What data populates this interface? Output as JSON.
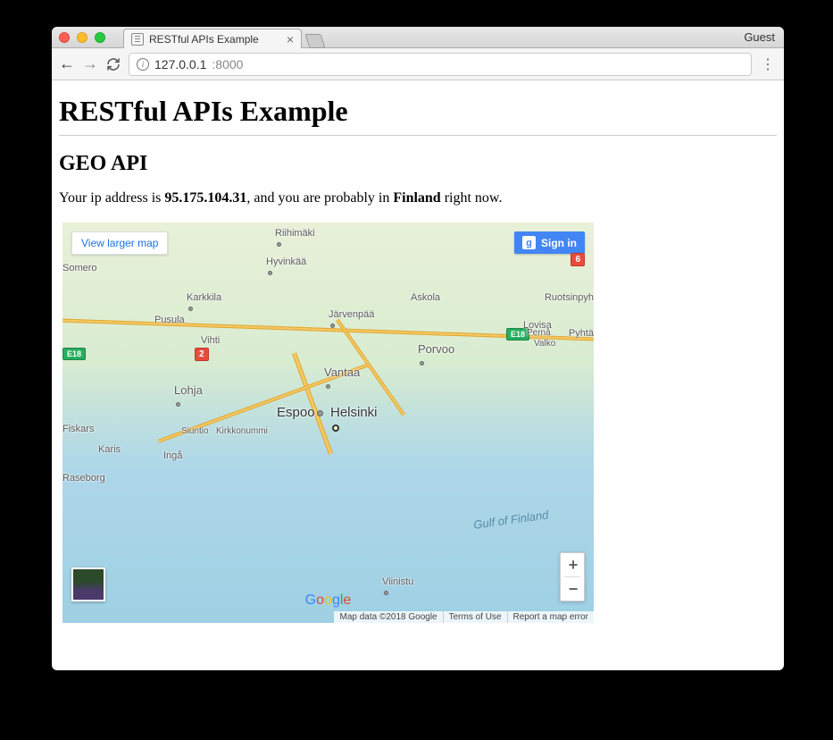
{
  "browser": {
    "guest_label": "Guest",
    "tab_title": "RESTful APIs Example",
    "url_host": "127.0.0.1",
    "url_port": ":8000"
  },
  "page": {
    "heading": "RESTful APIs Example",
    "subheading": "GEO API",
    "ip_prefix": "Your ip address is ",
    "ip_address": "95.175.104.31",
    "ip_mid": ", and you are probably in ",
    "country": "Finland",
    "ip_suffix": " right now."
  },
  "map": {
    "view_larger": "View larger map",
    "signin": "Sign in",
    "gulf_label": "Gulf of Finland",
    "attribution": "Map data ©2018 Google",
    "terms": "Terms of Use",
    "report": "Report a map error",
    "logo": "Google",
    "road_badges": {
      "r2": "2",
      "r6": "6",
      "e18a": "E18",
      "e18b": "E18"
    },
    "cities": {
      "riihimaki": "Riihimäki",
      "hyvinkaa": "Hyvinkää",
      "somero": "Somero",
      "karkkila": "Karkkila",
      "pusula": "Pusula",
      "vihti": "Vihti",
      "jarvenpaa": "Järvenpää",
      "askola": "Askola",
      "ruotsinpyh": "Ruotsinpyh",
      "lovisa": "Lovisa",
      "perna": "Pernå",
      "valko": "Valko",
      "pyhta": "Pyhtä",
      "porvoo": "Porvoo",
      "vantaa": "Vantaa",
      "lohja": "Lohja",
      "espoo": "Espoo",
      "helsinki": "Helsinki",
      "fiskars": "Fiskars",
      "karis": "Karis",
      "siuntio": "Siuntio",
      "kirkkonummi": "Kirkkonummi",
      "inga": "Ingå",
      "raseborg": "Raseborg",
      "viinistu": "Viinistu"
    }
  }
}
